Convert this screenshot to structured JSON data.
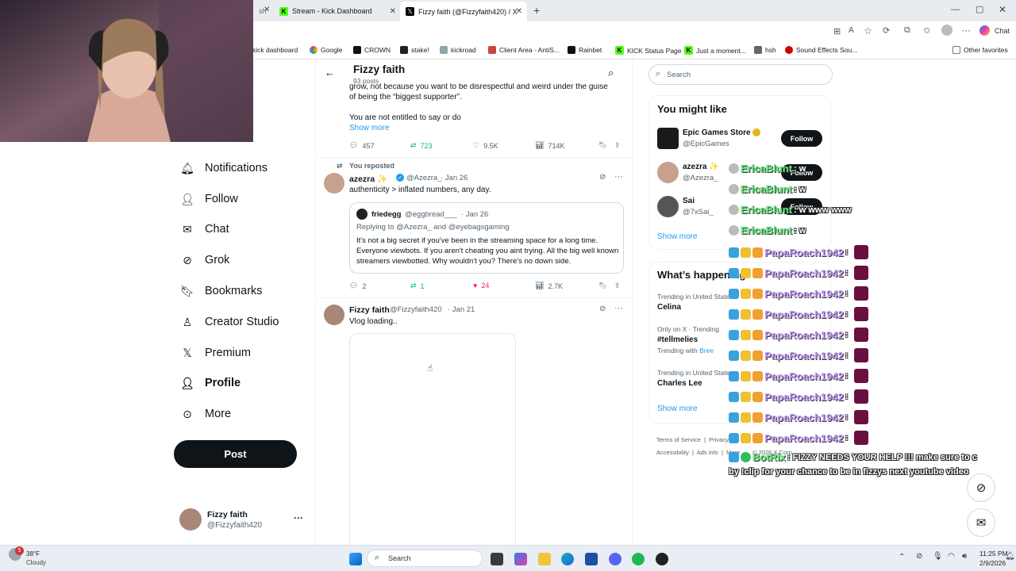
{
  "browser": {
    "tabs": [
      {
        "label": "Stream - Kick Dashboard"
      },
      {
        "label": "Fizzy faith (@Fizzyfaith420) / X"
      }
    ],
    "chat_label": "Chat",
    "bookmarks": [
      "kick dashboard",
      "Google",
      "CROWN",
      "stake!",
      "kickroad",
      "Client Area - AntiS...",
      "Rainbet",
      "KICK Status Page",
      "Just a moment...",
      "hsh",
      "Sound Effects Sou..."
    ],
    "other_favorites": "Other favorites"
  },
  "nav": {
    "items": [
      {
        "label": "Notifications",
        "icon": "bell-icon"
      },
      {
        "label": "Follow",
        "icon": "person-add-icon"
      },
      {
        "label": "Chat",
        "icon": "mail-icon"
      },
      {
        "label": "Grok",
        "icon": "grok-icon"
      },
      {
        "label": "Bookmarks",
        "icon": "bookmark-icon"
      },
      {
        "label": "Creator Studio",
        "icon": "creator-icon"
      },
      {
        "label": "Premium",
        "icon": "x-logo-icon"
      },
      {
        "label": "Profile",
        "icon": "profile-icon"
      },
      {
        "label": "More",
        "icon": "more-icon"
      }
    ],
    "post_label": "Post",
    "user": {
      "name": "Fizzy faith",
      "handle": "@Fizzyfaith420",
      "menu": "···"
    }
  },
  "header": {
    "title": "Fizzy faith",
    "subtitle": "93 posts"
  },
  "tweet1": {
    "partial_text_1": "grow, not because you want to be disrespectful and weird under the guise",
    "partial_text_2": "of being the “biggest supporter”.",
    "text_3": "You are not entitled to say or do",
    "show_more": "Show more",
    "replies": "457",
    "reposts": "723",
    "likes": "9.5K",
    "views": "714K"
  },
  "tweet2": {
    "reposted_label": "You reposted",
    "name": "azezra ✨",
    "handle": "@Azezra_",
    "date": "· Jan 26",
    "text": "authenticity > inflated numbers, any day.",
    "quote": {
      "name": "friedegg",
      "handle": "@eggbread___",
      "date": "· Jan 26",
      "replying": "Replying to @Azezra_ and @eyebagsgaming",
      "text": "It's not a big secret if you've been in the streaming space for a long time. Everyone viewbots. If you aren't cheating you aint trying. All the big well known streamers viewbotted. Why wouldn't you? There's no down side."
    },
    "replies": "2",
    "reposts": "1",
    "likes": "24",
    "views": "2.7K"
  },
  "tweet3": {
    "name": "Fizzy faith",
    "handle": "@Fizzyfaith420",
    "date": "· Jan 21",
    "text": "Vlog loading.."
  },
  "right": {
    "search_placeholder": "Search",
    "you_might_like": "You might like",
    "suggestions": [
      {
        "name": "Epic Games Store",
        "handle": "@EpicGames",
        "follow": "Follow"
      },
      {
        "name": "azezra ✨",
        "handle": "@Azezra_",
        "follow": "Follow"
      },
      {
        "name": "Sai",
        "handle": "@7xSai_",
        "follow": "Follow"
      }
    ],
    "show_more": "Show more",
    "whats_happening": "What’s happening",
    "trends": [
      {
        "context": "Trending in United States",
        "topic": "Celina",
        "extra": ""
      },
      {
        "context": "Only on X · Trending",
        "topic": "#tellmelies",
        "extra": "Trending with"
      },
      {
        "context": "Trending in United States",
        "topic": "Charles Lee",
        "extra": ""
      }
    ],
    "trend_with_link": "Bree",
    "show_more_2": "Show more",
    "footer": [
      "Terms of Service",
      "Privacy",
      "Accessibility",
      "Ads info",
      "More ···",
      "© 2026 X Corp."
    ]
  },
  "chat_overlay": {
    "lines": [
      {
        "user": "EricaBlunt",
        "msg": ": w"
      },
      {
        "user": "EricaBlunt",
        "msg": ": w"
      },
      {
        "user": "EricaBlunt",
        "msg": ": w www www"
      },
      {
        "user": "EricaBlunt",
        "msg": ": w"
      },
      {
        "user": "PapaRoach1942",
        "msg": ":"
      },
      {
        "user": "PapaRoach1942",
        "msg": ":"
      },
      {
        "user": "PapaRoach1942",
        "msg": ":"
      },
      {
        "user": "PapaRoach1942",
        "msg": ":"
      },
      {
        "user": "PapaRoach1942",
        "msg": ":"
      },
      {
        "user": "PapaRoach1942",
        "msg": ":"
      },
      {
        "user": "PapaRoach1942",
        "msg": ":"
      },
      {
        "user": "PapaRoach1942",
        "msg": ":"
      },
      {
        "user": "PapaRoach1942",
        "msg": ":"
      },
      {
        "user": "PapaRoach1942",
        "msg": ":"
      }
    ],
    "bot_user": "BotRix",
    "bot_msg_1": ": FIZZY NEEDS YOUR HELP !!! make sure to c",
    "bot_msg_2": "by !clip for your chance to be in fizzys next youtube video"
  },
  "taskbar": {
    "weather_temp": "38°F",
    "weather_desc": "Cloudy",
    "search_label": "Search",
    "time": "11:25 PM",
    "date": "2/9/2026",
    "notif_count": "5"
  }
}
